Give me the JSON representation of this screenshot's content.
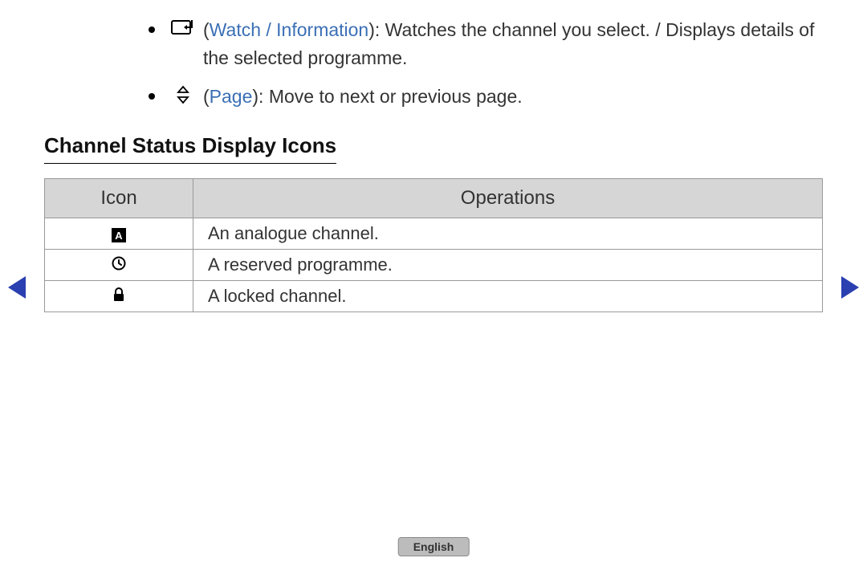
{
  "bullets": {
    "watch": {
      "label": "Watch / Information",
      "text_after": "): Watches the channel you select. / Displays details of the selected programme."
    },
    "page": {
      "label": "Page",
      "text_after": "): Move to next or previous page."
    }
  },
  "section_heading": "Channel Status Display Icons",
  "table": {
    "headers": {
      "icon": "Icon",
      "operations": "Operations"
    },
    "rows": [
      {
        "icon_name": "analogue-a-icon",
        "operation": "An analogue channel."
      },
      {
        "icon_name": "clock-icon",
        "operation": "A reserved programme."
      },
      {
        "icon_name": "lock-icon",
        "operation": "A locked channel."
      }
    ],
    "analogue_letter": "A"
  },
  "footer_language": "English"
}
